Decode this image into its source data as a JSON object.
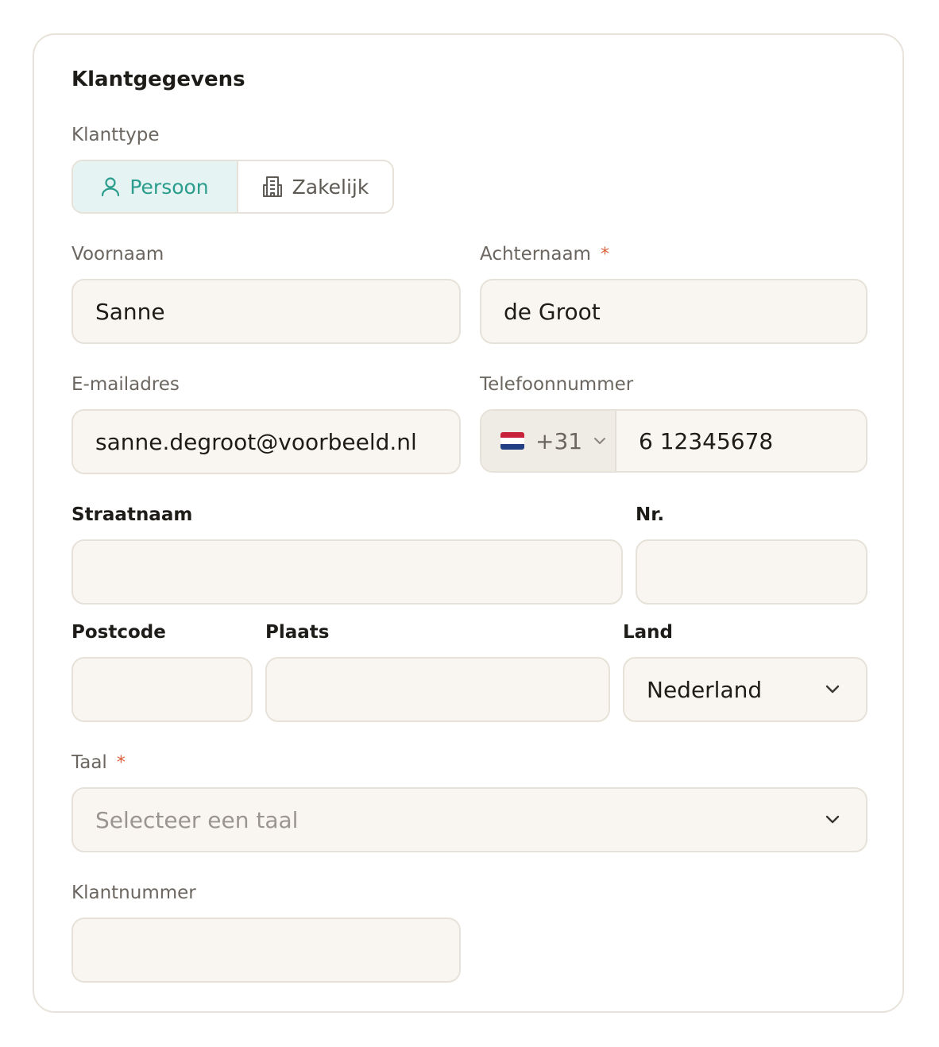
{
  "form": {
    "title": "Klantgegevens",
    "customer_type": {
      "label": "Klanttype",
      "options": [
        {
          "label": "Persoon",
          "icon": "user-icon",
          "selected": true
        },
        {
          "label": "Zakelijk",
          "icon": "building-icon",
          "selected": false
        }
      ]
    },
    "first_name": {
      "label": "Voornaam",
      "value": "Sanne"
    },
    "last_name": {
      "label": "Achternaam",
      "required_mark": "*",
      "value": "de Groot"
    },
    "email": {
      "label": "E-mailadres",
      "value": "sanne.degroot@voorbeeld.nl"
    },
    "phone": {
      "label": "Telefoonnummer",
      "country_code": "+31",
      "flag": "netherlands-flag-icon",
      "value": "6 12345678"
    },
    "street": {
      "label": "Straatnaam",
      "value": ""
    },
    "house_number": {
      "label": "Nr.",
      "value": ""
    },
    "postcode": {
      "label": "Postcode",
      "value": ""
    },
    "city": {
      "label": "Plaats",
      "value": ""
    },
    "country": {
      "label": "Land",
      "value": "Nederland"
    },
    "language": {
      "label": "Taal",
      "required_mark": "*",
      "placeholder": "Selecteer een taal"
    },
    "customer_number": {
      "label": "Klantnummer",
      "value": ""
    }
  },
  "colors": {
    "accent": "#2a9d8c",
    "accent_bg": "#e5f3f2",
    "required": "#d9603b",
    "input_bg": "#f9f6f1",
    "border": "#e7e2d9"
  }
}
